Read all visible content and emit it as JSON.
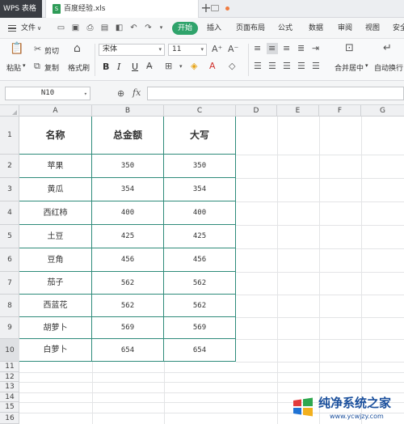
{
  "titlebar": {
    "app_name": "WPS 表格",
    "document_tab": "百度经验.xls",
    "new_tab": "+"
  },
  "menu": {
    "file": "文件",
    "file_arrow": "∨",
    "start": "开始",
    "items": [
      "插入",
      "页面布局",
      "公式",
      "数据",
      "审阅",
      "视图",
      "安全"
    ]
  },
  "ribbon": {
    "paste": "粘贴",
    "cut": "剪切",
    "copy": "复制",
    "format_painter": "格式刷",
    "font_name": "宋体",
    "font_size": "11",
    "bold": "B",
    "italic": "I",
    "underline": "U",
    "merge_center": "合并居中",
    "wrap_text": "自动换行"
  },
  "formula_bar": {
    "name_box": "N10",
    "fx": "fx",
    "formula": ""
  },
  "grid": {
    "columns": [
      "A",
      "B",
      "C",
      "D",
      "E",
      "F",
      "G"
    ],
    "rows": [
      "1",
      "2",
      "3",
      "4",
      "5",
      "6",
      "7",
      "8",
      "9",
      "10",
      "11",
      "12",
      "13",
      "14",
      "15",
      "16"
    ],
    "active_row": "10"
  },
  "table": {
    "headers": [
      "名称",
      "总金额",
      "大写"
    ],
    "rows": [
      [
        "苹果",
        "350",
        "350"
      ],
      [
        "黄瓜",
        "354",
        "354"
      ],
      [
        "西红柿",
        "400",
        "400"
      ],
      [
        "土豆",
        "425",
        "425"
      ],
      [
        "豆角",
        "456",
        "456"
      ],
      [
        "茄子",
        "562",
        "562"
      ],
      [
        "西蓝花",
        "562",
        "562"
      ],
      [
        "胡萝卜",
        "569",
        "569"
      ],
      [
        "白萝卜",
        "654",
        "654"
      ]
    ]
  },
  "watermark": {
    "title": "纯净系统之家",
    "url": "www.ycwjzy.com"
  },
  "colors": {
    "accent_green": "#2fa36b",
    "table_border": "#2e8b7a",
    "watermark_blue": "#1a4f9c"
  }
}
